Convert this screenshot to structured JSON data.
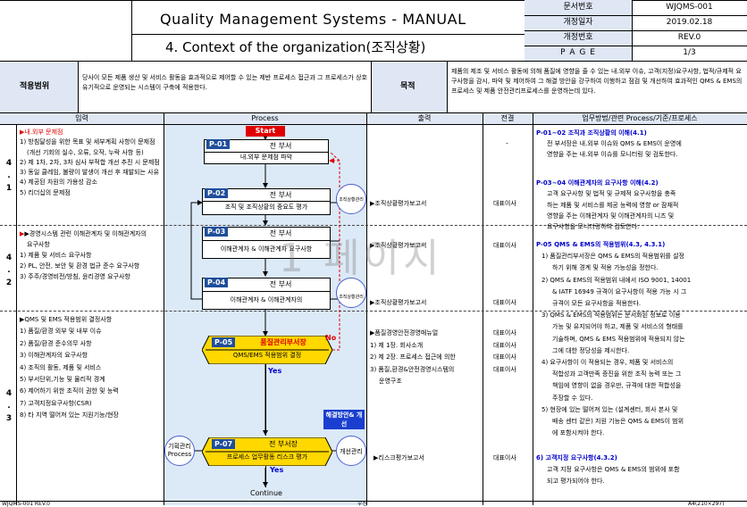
{
  "header": {
    "title": "Quality Management Systems - MANUAL",
    "subtitle": "4. Context of the organization(조직상황)",
    "meta": [
      {
        "label": "문서번호",
        "value": "WJQMS-001"
      },
      {
        "label": "개정일자",
        "value": "2019.02.18"
      },
      {
        "label": "개정번호",
        "value": "REV.0"
      },
      {
        "label": "P A G E",
        "value": "1/3"
      }
    ]
  },
  "intro": {
    "scope_label": "적용범위",
    "scope_text": "당사이 모든 제품 생산 및 서비스 활동을 효과적으로 제어할 수 있는 제반 프로세스 접근과 그 프로세스가 상호 유기적으로 운영되는 시스템이 구축에 적용한다.",
    "purpose_label": "목적",
    "purpose_text": "제품의 제조 및 서비스 활동에 의해 품질에 영향을 줄 수 있는 내.외부 이슈, 고객(지정)요구사항, 법적/규제적 요구사항을 감시, 파악 및 제어하여 그 해결 방안을 강구하여 이행하고 점검 및 개선하여 효과적인 QMS & EMS의 프로세스 및 제품 안전관리프로세스를 운영하는데 있다."
  },
  "columns": {
    "input": "입력",
    "process": "Process",
    "output": "출력",
    "resp": "전결",
    "method": "업무방법/관련 Process/기준/프로세스"
  },
  "sections": [
    {
      "num": "4 . 1",
      "items": [
        "▶내.외부 문제점",
        "1) 방침달성을 위한 목표 및 세부계획 사항이 문제점",
        "(개선 기회의 실수, 오류, 오작, 누락 사항 등)",
        "2) 제 1차, 2차, 3차 심사 부적합 개선 추진 시 문제점",
        "3) 동일 클레임, 불량이 발생이 개선 후 재발되는 사유",
        "4) 제공된 자원의 가용성 감소",
        "5) 리더십의 문제점"
      ]
    },
    {
      "num": "4 . 2",
      "items": [
        "▶경영시스템 관련 이해관계자 및 이해관계자의",
        "요구사항",
        "1) 제품 및 서비스 요구사항",
        "2) PL, 안전, 보안 및 환경 법규 준수 요구사항",
        "3) 주주/경영비전/방침, 윤리경영 요구사항"
      ]
    },
    {
      "num": "4 . 3",
      "items": [
        "▶QMS 및 EMS 적용범위 결정사항",
        "1) 품질/환경 외부 및 내부 이슈",
        "2) 품질/환경 준수의무 사항",
        "3) 이해관계자의 요구사항",
        "4) 조직의 활동, 제품 및 서비스",
        "5) 부서단위,기능 및 물리적 경계",
        "6) 제어하기 위한 조직이 권한 및 능력",
        "7) 고객지정요구사항(CSR)",
        "8) 타 지역 떨어져 있는 지원기능/현장"
      ]
    }
  ],
  "process": {
    "start": "Start",
    "continue": "Continue",
    "steps": [
      {
        "id": "P-01",
        "dept": "전 부서",
        "name": "내.외부 문제점 파악"
      },
      {
        "id": "P-02",
        "dept": "전 부서",
        "name": "조직 및 조직상황의 중요도 평가"
      },
      {
        "id": "P-03",
        "dept": "전 부서",
        "name": "이해관계자 & 이해관계자 요구사항"
      },
      {
        "id": "P-04",
        "dept": "전 부서",
        "name": "이해관계자 & 이해관계자의"
      },
      {
        "id": "P-05",
        "dept": "품질관리부서장",
        "name": "QMS/EMS 적용범위 결정"
      },
      {
        "id": "P-07",
        "dept": "전 부서장",
        "name": "프로세스 업무활동 리스크 평가"
      }
    ],
    "no": "No",
    "yes": "Yes",
    "circle1": "조직상황관리",
    "circle2": "조직상황관리",
    "circle3": "기획관리 Process",
    "circle4": "개선관리",
    "callout": "해결방안& 개선"
  },
  "outputs": [
    {
      "text": "▶조직상황평가보고서",
      "resp": "대표이사"
    },
    {
      "text": "▶조직상황평가보고서",
      "resp": "대표이사"
    },
    {
      "text": "▶조직상황평가보고서",
      "resp": "대표이사"
    },
    {
      "text": "▶품질경영안전경영매뉴얼",
      "resp": "대표이사"
    },
    {
      "text": "1) 제 1장. 회사소개",
      "resp": "대표이사"
    },
    {
      "text": "2) 제 2장. 프로세스 접근에 의한",
      "resp": "대표이사"
    },
    {
      "text": "3) 품질,환경&안전경영시스템의",
      "resp": "대표이사"
    },
    {
      "text": "운영구조",
      "resp": ""
    },
    {
      "text": "▶리스크평가보고서",
      "resp": "대표이사"
    }
  ],
  "first_resp": "-",
  "methods": [
    {
      "head": "P-01~02 조직과 조직상황의 이해(4.1)",
      "lines": [
        "전 부서장은 내.외부 이슈와 QMS & EMS이 운영에",
        "영향을 주는 내.외부 이슈를 모니터링 및 검토한다."
      ]
    },
    {
      "head": "P-03~04 이해관계자의 요구사항 이해(4.2)",
      "lines": [
        "고객 요구사항 및 법적 및 규제적 요구사항을 충족",
        "하는 제품 및 서비스를 제공 능력에 영향 or 잠재적",
        "영향을 주는 이해관계자 및 이해관계자의 니즈 및",
        "요구사항을 모니터링하여 검토한다."
      ]
    },
    {
      "head": "P-05 QMS & EMS의 적용범위(4.3, 4.3.1)",
      "lines": [
        "1) 품질관리부서장은 QMS & EMS의 적용범위를 설정",
        "하기 위해 경계 및 적용 가능성을 정한다.",
        "2) QMS & EMS의 적용범위 내에서 ISO 9001, 14001",
        "& IATF 16949 규격이 요구사항이 적용 가능 시 그",
        "규격이 모든 요구사항을 적용한다.",
        "3) QMS & EMS의 적용범위는 문서화된 정보로 이용",
        "가능 및 유지되어야 하고, 제품 및 서비스의 형태를",
        "기술하며, QMS & EMS 적용범위에 적용되지 않는",
        "그에 대한 정당성을 제시한다.",
        "4) 요구사항이 이 적용되는 경우, 제품 및 서비스의",
        "적합성과 고객만족 증진을 위한 조직 능력 또는 그",
        "책임에 영향이 없을 경우만, 규격에 대한 적합성을",
        "주장할 수 있다.",
        "5) 현장에 있는 떨어져 있는 (설계센터, 회사 본사 및",
        "배송 센터 같은) 지원 기능은 QMS & EMS이 범위",
        "에 포함시켜야 한다."
      ]
    },
    {
      "head": "6) 고객지정 요구사항(4.3.2)",
      "lines": [
        "고객 지정 요구사항은 QMS & EMS의 범위에 포함",
        "되고 평가되어야 한다."
      ]
    }
  ],
  "watermark": "1 페이지",
  "footer": {
    "left": "WJQMS-001 REV.0",
    "center": "우진",
    "right": "A4(210×297)"
  }
}
